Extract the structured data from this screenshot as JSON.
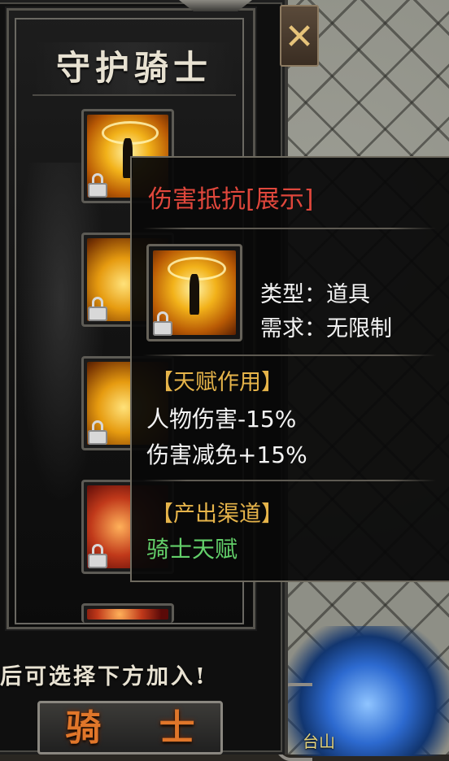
{
  "panel": {
    "title": "守护骑士",
    "hint_text": "后可选择下方加入!",
    "join_button_label": "骑 士"
  },
  "skills": [
    {
      "name": "伤害抵抗",
      "icon": "halo-warrior-icon",
      "locked": true
    },
    {
      "name": "",
      "icon": "golden-swirl-icon",
      "locked": true
    },
    {
      "name": "",
      "icon": "golden-vortex-icon",
      "locked": true
    },
    {
      "name": "",
      "icon": "flame-arm-icon",
      "locked": true
    }
  ],
  "close_button": {
    "label": "✕"
  },
  "map": {
    "place_label": "台山"
  },
  "tooltip": {
    "title": "伤害抵抗[展示]",
    "type_line": "类型：道具",
    "require_line": "需求：无限制",
    "talent_header": "【天赋作用】",
    "effects": [
      "人物伤害-15%",
      "伤害减免+15%"
    ],
    "source_header": "【产出渠道】",
    "source": "骑士天赋"
  },
  "colors": {
    "tooltip_title": "#e0473c",
    "section_header": "#e6b44a",
    "source_text": "#63d06a",
    "button_text": "#e0762a"
  }
}
